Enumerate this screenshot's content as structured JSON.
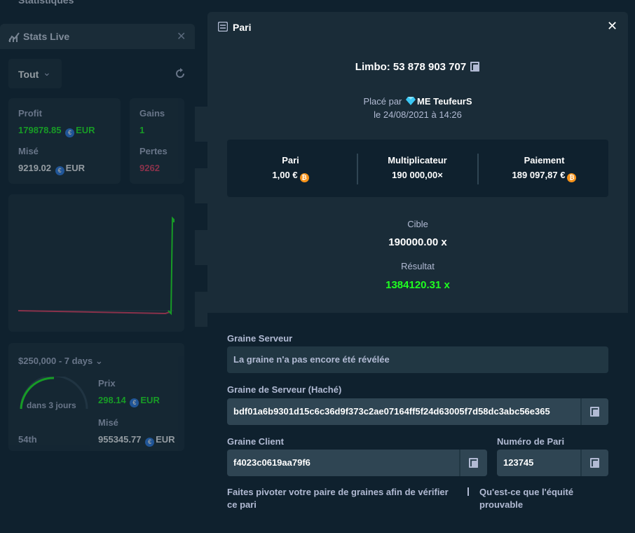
{
  "background": {
    "top_text": "Statistiques",
    "stats": {
      "title": "Stats Live",
      "filter": "Tout",
      "profit_label": "Profit",
      "profit_value": "179878.85",
      "profit_currency": "EUR",
      "wagered_label": "Misé",
      "wagered_value": "9219.02",
      "wagered_currency": "EUR",
      "wins_label": "Gains",
      "wins_value": "1",
      "losses_label": "Pertes",
      "losses_value": "9262",
      "race_title": "$250,000 - 7 days",
      "race_timer": "dans 3 jours",
      "race_rank": "54th",
      "prize_label": "Prix",
      "prize_value": "298.14",
      "prize_currency": "EUR",
      "race_wagered_label": "Misé",
      "race_wagered_value": "955345.77",
      "race_wagered_currency": "EUR"
    }
  },
  "modal": {
    "title": "Pari",
    "bet_id": "Limbo: 53 878 903 707",
    "placed_by_prefix": "Placé par",
    "user": "ME TeufeurS",
    "date": "le 24/08/2021 à 14:26",
    "summary": {
      "bet_label": "Pari",
      "bet_value": "1,00 €",
      "multiplier_label": "Multiplicateur",
      "multiplier_value": "190 000,00×",
      "payout_label": "Paiement",
      "payout_value": "189 097,87 €"
    },
    "target_label": "Cible",
    "target_value": "190000.00 x",
    "result_label": "Résultat",
    "result_value": "1384120.31 x",
    "fairness": {
      "server_seed_label": "Graine Serveur",
      "server_seed_value": "La graine n'a pas encore été révélée",
      "hashed_seed_label": "Graine de Serveur (Haché)",
      "hashed_seed_value": "bdf01a6b9301d15c6c36d9f373c2ae07164ff5f24d63005f7d58dc3abc56e365",
      "client_seed_label": "Graine Client",
      "client_seed_value": "f4023c0619aa79f6",
      "nonce_label": "Numéro de Pari",
      "nonce_value": "123745",
      "rotate_link": "Faites pivoter votre paire de graines afin de vérifier ce pari",
      "provable_link": "Qu'est-ce que l'équité prouvable"
    }
  },
  "colors": {
    "bg": "#0f212e",
    "panel": "#1a2c38",
    "input": "#2f4553",
    "green": "#1fff20",
    "red": "#ed4163",
    "text_muted": "#b1bad3"
  },
  "icons": [
    "chart-icon",
    "close-icon",
    "chevron-down-icon",
    "refresh-icon",
    "eur-coin-icon",
    "btc-coin-icon",
    "copy-icon",
    "bet-slip-icon",
    "diamond-icon"
  ]
}
